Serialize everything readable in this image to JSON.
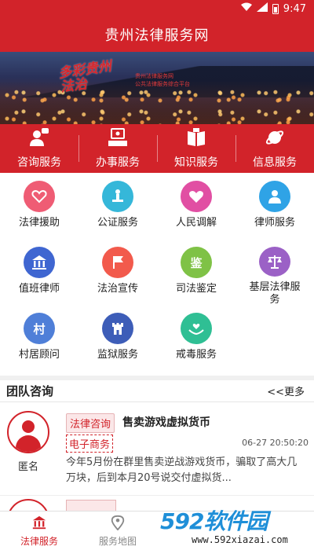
{
  "status_bar": {
    "time": "9:47",
    "icons": [
      "wifi-icon",
      "signal-icon",
      "battery-icon"
    ]
  },
  "app": {
    "title": "贵州法律服务网",
    "brand_color": "#d2232a"
  },
  "banner": {
    "logo_text": "多彩贵州 法治",
    "caption_line1": "贵州法律服务网",
    "caption_line2": "公共法律服务综合平台"
  },
  "main_services": [
    {
      "label": "咨询服务",
      "icon": "chat-user-icon"
    },
    {
      "label": "办事服务",
      "icon": "desk-user-icon"
    },
    {
      "label": "知识服务",
      "icon": "book-icon"
    },
    {
      "label": "信息服务",
      "icon": "planet-icon"
    }
  ],
  "grid": [
    {
      "label": "法律援助",
      "icon": "heart-hands-icon",
      "color": "#ef5c74"
    },
    {
      "label": "公证服务",
      "icon": "stamp-icon",
      "color": "#35b7d9"
    },
    {
      "label": "人民调解",
      "icon": "heart-icon",
      "color": "#e14fa3"
    },
    {
      "label": "律师服务",
      "icon": "lawyer-icon",
      "color": "#2fa3e6"
    },
    {
      "label": "值班律师",
      "icon": "courthouse-icon",
      "color": "#3f66d1"
    },
    {
      "label": "法治宣传",
      "icon": "flag-icon",
      "color": "#f25a4c"
    },
    {
      "label": "司法鉴定",
      "icon": "appraisal-icon",
      "glyph": "鉴",
      "color": "#7fc246"
    },
    {
      "label": "基层法律服务",
      "icon": "scales-icon",
      "color": "#9b61c6"
    },
    {
      "label": "村居顾问",
      "icon": "village-icon",
      "glyph": "村",
      "color": "#4f7fd8"
    },
    {
      "label": "监狱服务",
      "icon": "tower-icon",
      "color": "#3d5db8"
    },
    {
      "label": "戒毒服务",
      "icon": "care-hands-icon",
      "color": "#2fbf94"
    }
  ],
  "team_consult": {
    "title": "团队咨询",
    "more": "<<更多",
    "items": [
      {
        "user": "匿名",
        "category": "法律咨询",
        "sub_category": "电子商务",
        "title": "售卖游戏虚拟货币",
        "time": "06-27 20:50:20",
        "body": "今年5月份在群里售卖逆战游戏货币，骗取了高大几万块，后到本月20号说交付虚拟货..."
      }
    ]
  },
  "tabbar": [
    {
      "label": "法律服务",
      "icon": "courthouse-icon",
      "active": true
    },
    {
      "label": "服务地图",
      "icon": "map-pin-icon",
      "active": false
    }
  ],
  "watermark": {
    "brand": "592软件园",
    "url": "www.592xiazai.com"
  }
}
